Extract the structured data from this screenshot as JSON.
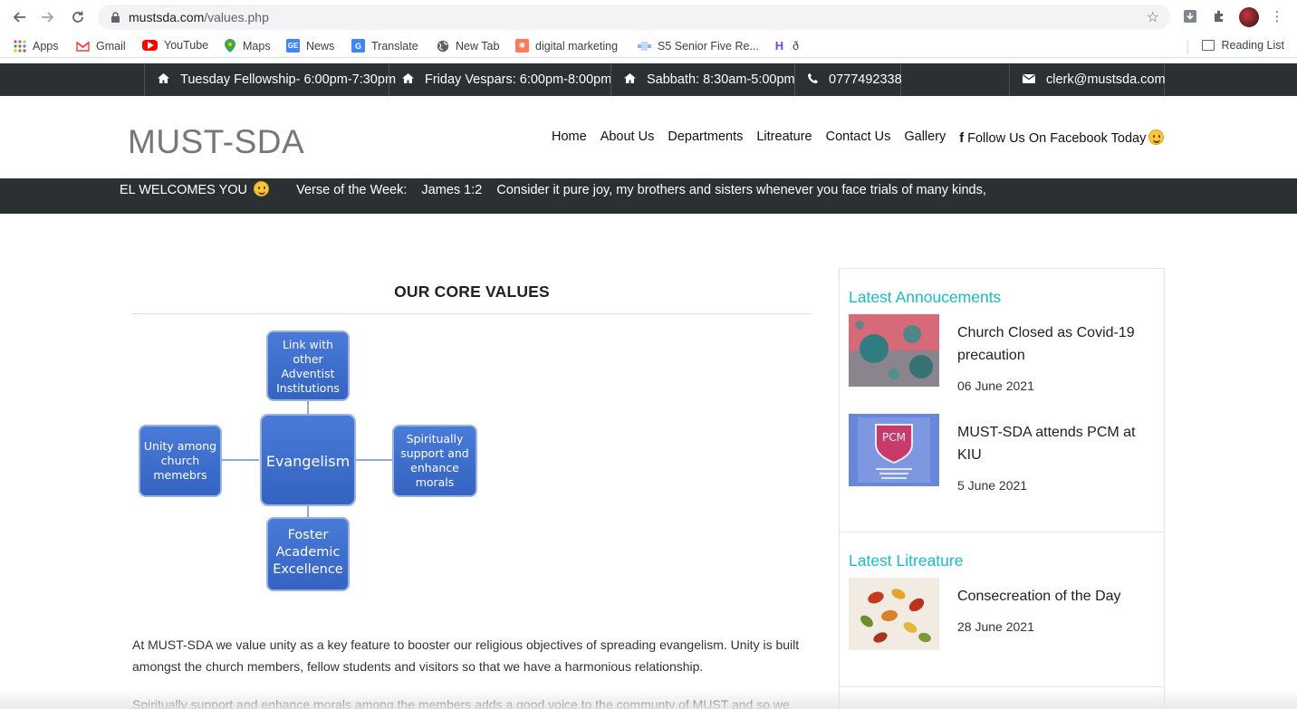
{
  "browser": {
    "url_host": "mustsda.com",
    "url_path": "/values.php",
    "bookmarks": [
      {
        "label": "Apps",
        "icon": "apps-grid-icon"
      },
      {
        "label": "Gmail",
        "icon": "gmail-icon"
      },
      {
        "label": "YouTube",
        "icon": "youtube-icon"
      },
      {
        "label": "Maps",
        "icon": "maps-icon"
      },
      {
        "label": "News",
        "icon": "news-icon"
      },
      {
        "label": "Translate",
        "icon": "translate-icon"
      },
      {
        "label": "New Tab",
        "icon": "globe-icon"
      },
      {
        "label": "digital marketing",
        "icon": "hubspot-icon"
      },
      {
        "label": "S5 Senior Five Re...",
        "icon": "bookmark-icon"
      },
      {
        "label": "ð",
        "icon": "h-logo-icon"
      }
    ],
    "reading_list": "Reading List"
  },
  "topbar": {
    "items": [
      {
        "label": "Tuesday Fellowship- 6:00pm-7:30pm",
        "icon": "home-icon"
      },
      {
        "label": "Friday Vespars: 6:00pm-8:00pm",
        "icon": "home-icon"
      },
      {
        "label": "Sabbath: 8:30am-5:00pm",
        "icon": "home-icon"
      },
      {
        "label": "0777492338",
        "icon": "phone-icon"
      }
    ],
    "email": "clerk@mustsda.com"
  },
  "header": {
    "logo": "MUST-SDA",
    "menu": [
      "Home",
      "About Us",
      "Departments",
      "Litreature",
      "Contact Us",
      "Gallery"
    ],
    "facebook": "Follow Us On Facebook Today"
  },
  "marquee": {
    "welcome": "EL WELCOMES YOU",
    "verse_label": "Verse of the Week:",
    "verse_ref": "James 1:2",
    "verse_text": "Consider it pure joy, my brothers and sisters whenever you face trials of many kinds,"
  },
  "main": {
    "title": "OUR CORE VALUES",
    "diagram": {
      "center": "Evangelism",
      "top": [
        "Link with",
        "other",
        "Adventist",
        "Institutions"
      ],
      "left": [
        "Unity among",
        "church",
        "memebrs"
      ],
      "right": [
        "Spiritually",
        "support and",
        "enhance",
        "morals"
      ],
      "bottom": [
        "Foster",
        "Academic",
        "Excellence"
      ]
    },
    "paragraphs": [
      "At MUST-SDA we value unity as a key feature to booster our religious objectives of spreading evangelism. Unity is built amongst the church members, fellow students and visitors so that we have a harmonious relationship.",
      "Spiritually support and enhance morals among the members adds a good voice to the communty of MUST and so we"
    ]
  },
  "sidebar": {
    "announcements_heading": "Latest Annoucements",
    "announcements": [
      {
        "title": "Church Closed as Covid-19 precaution",
        "date": "06 June 2021"
      },
      {
        "title": "MUST-SDA attends PCM at KIU",
        "date": "5 June 2021"
      }
    ],
    "literature_heading": "Latest Litreature",
    "literature": [
      {
        "title": "Consecreation of the Day",
        "date": "28 June 2021"
      }
    ],
    "pcm_badge": "PCM"
  },
  "colors": {
    "topbar_bg": "#2b3033",
    "accent_teal": "#17bcc8",
    "diagram_blue": "#3f6fcf"
  }
}
